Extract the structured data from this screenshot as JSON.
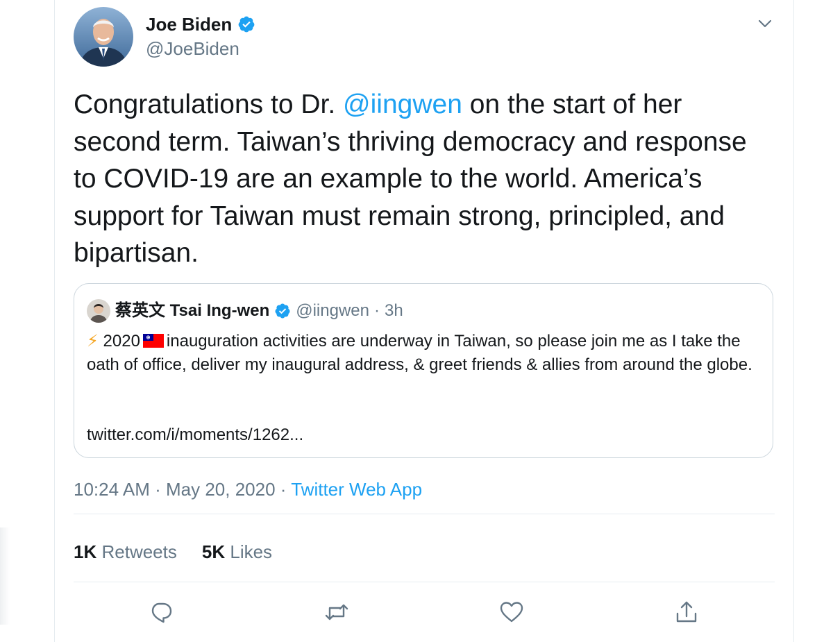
{
  "author": {
    "display_name": "Joe Biden",
    "handle": "@JoeBiden",
    "verified": true
  },
  "tweet": {
    "text_before": "Congratulations to Dr. ",
    "mention": "@iingwen",
    "text_after": " on the start of her second term. Taiwan’s thriving democracy and response to COVID-19 are an example to the world. America’s support for Taiwan must remain strong, principled, and bipartisan."
  },
  "quoted_tweet": {
    "display_name": "蔡英文 Tsai Ing-wen",
    "handle": "@iingwen",
    "time": "3h",
    "bolt": "⚡",
    "year": "2020",
    "text_after_flag": "inauguration activities are underway in Taiwan, so please join me as I take the oath of office, deliver my inaugural address, & greet friends & allies from around the globe.",
    "link": "twitter.com/i/moments/1262..."
  },
  "meta": {
    "time": "10:24 AM",
    "date": "May 20, 2020",
    "source": "Twitter Web App",
    "separator": "·"
  },
  "stats": {
    "retweets_count": "1K",
    "retweets_label": "Retweets",
    "likes_count": "5K",
    "likes_label": "Likes"
  },
  "colors": {
    "accent": "#1da1f2",
    "muted": "#657786",
    "border": "#ccd6dd"
  },
  "icons": [
    "verified-badge-icon",
    "chevron-down-icon",
    "reply-icon",
    "retweet-icon",
    "like-icon",
    "share-icon",
    "taiwan-flag-icon"
  ]
}
